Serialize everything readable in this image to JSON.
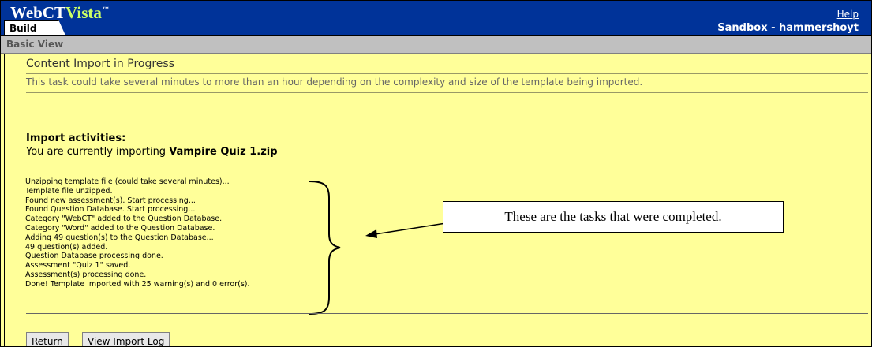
{
  "header": {
    "logo_main": "WebCT",
    "logo_accent": "Vista",
    "logo_tm": "™",
    "help_link": "Help",
    "active_tab": "Build",
    "course_context": "Sandbox - hammershoyt"
  },
  "view_bar": {
    "label": "Basic View"
  },
  "main": {
    "title": "Content Import in Progress",
    "description": "This task could take several minutes to more than an hour depending on the complexity and size of the template being imported.",
    "activities_heading": "Import activities:",
    "importing_prefix": "You are currently importing ",
    "importing_file": "Vampire Quiz 1.zip",
    "log_lines": [
      "Unzipping template file (could take several minutes)...",
      "Template file unzipped.",
      "Found new assessment(s). Start processing...",
      "Found Question Database. Start processing...",
      "Category \"WebCT\" added to the Question Database.",
      "Category \"Word\" added to the Question Database.",
      "Adding 49 question(s) to the Question Database...",
      "49 question(s) added.",
      "Question Database processing done.",
      "Assessment \"Quiz 1\" saved.",
      "Assessment(s) processing done.",
      "Done! Template imported with 25 warning(s) and 0 error(s)."
    ]
  },
  "annotation": {
    "callout_text": "These are the tasks that were completed."
  },
  "buttons": {
    "return_label": "Return",
    "view_log_label": "View Import Log"
  },
  "colors": {
    "header_bg": "#003399",
    "content_bg": "#ffff99",
    "logo_accent": "#ccff66"
  }
}
